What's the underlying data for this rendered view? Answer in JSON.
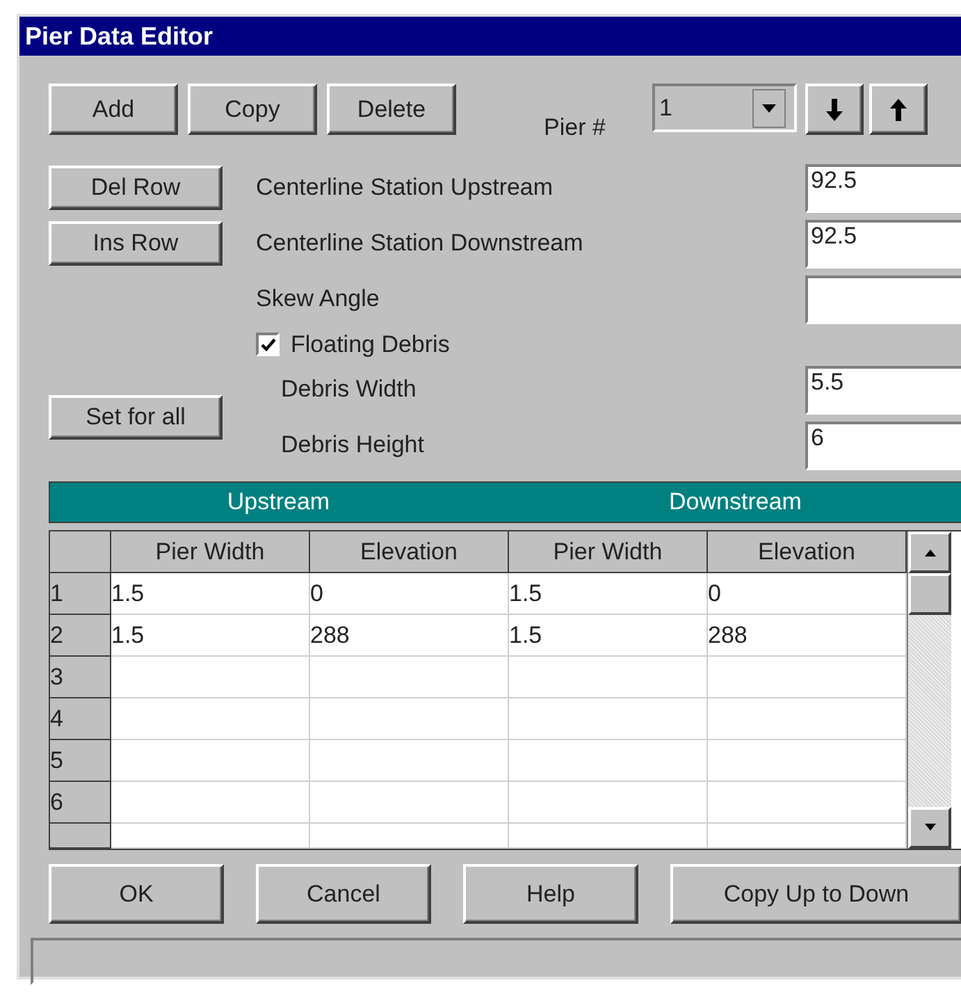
{
  "window": {
    "title": "Pier Data Editor"
  },
  "toolbar": {
    "buttons": [
      "Add",
      "Copy",
      "Delete"
    ],
    "pier_label": "Pier #",
    "pier_value": "1"
  },
  "row_buttons": [
    "Del Row",
    "Ins Row"
  ],
  "fields": [
    {
      "label": "Centerline Station Upstream",
      "value": "92.5"
    },
    {
      "label": "Centerline Station Downstream",
      "value": "92.5"
    },
    {
      "label": "Skew Angle"
    }
  ],
  "floating_debris": {
    "label": "Floating Debris",
    "checked": true
  },
  "debris_fields": [
    {
      "label": "Debris Width",
      "value": "5.5"
    },
    {
      "label": "Debris Height",
      "value": "6"
    }
  ],
  "set_for_all": "Set for all",
  "table": {
    "groups": [
      "Upstream",
      "Downstream"
    ],
    "columns": [
      "Pier Width",
      "Elevation",
      "Pier Width",
      "Elevation"
    ],
    "rows": [
      {
        "label": "1",
        "cells": [
          "1.5",
          "0",
          "1.5",
          "0"
        ]
      },
      {
        "label": "2",
        "cells": [
          "1.5",
          "288",
          "1.5",
          "288"
        ]
      },
      {
        "label": "3"
      },
      {
        "label": "4"
      },
      {
        "label": "5"
      },
      {
        "label": "6"
      }
    ]
  },
  "buttons": [
    "OK",
    "Cancel",
    "Help",
    "Copy Up to Down"
  ]
}
